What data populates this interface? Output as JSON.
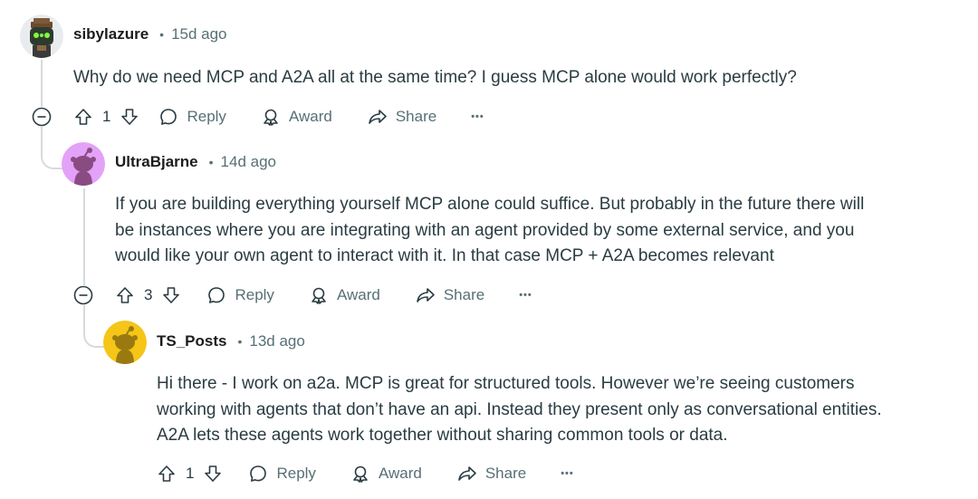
{
  "comments": [
    {
      "username": "sibylazure",
      "separator": "•",
      "time": "15d ago",
      "body": "Why do we need MCP and A2A all at the same time? I guess MCP alone would work perfectly?",
      "votes": "1",
      "actions": {
        "reply": "Reply",
        "award": "Award",
        "share": "Share",
        "more": "•••"
      },
      "avatar_icon": "robot-avatar-icon"
    },
    {
      "username": "UltraBjarne",
      "separator": "•",
      "time": "14d ago",
      "body_lines": [
        "If you are building everything yourself MCP alone could suffice. But probably in the future there will",
        "be instances where you are integrating with an agent provided by some external service, and you",
        "would like your own agent to interact with it. In that case MCP + A2A becomes relevant"
      ],
      "votes": "3",
      "actions": {
        "reply": "Reply",
        "award": "Award",
        "share": "Share",
        "more": "•••"
      },
      "avatar_color": "#e3a2f7",
      "avatar_icon": "snoo-avatar-icon"
    },
    {
      "username": "TS_Posts",
      "separator": "•",
      "time": "13d ago",
      "body_lines": [
        "Hi there - I work on a2a. MCP is great for structured tools. However we’re seeing customers",
        "working with agents that don’t have an api. Instead they present only as conversational entities.",
        "A2A lets these agents work together without sharing common tools or data."
      ],
      "votes": "1",
      "actions": {
        "reply": "Reply",
        "award": "Award",
        "share": "Share",
        "more": "•••"
      },
      "avatar_color": "#f5c518",
      "avatar_icon": "snoo-avatar-icon"
    }
  ]
}
